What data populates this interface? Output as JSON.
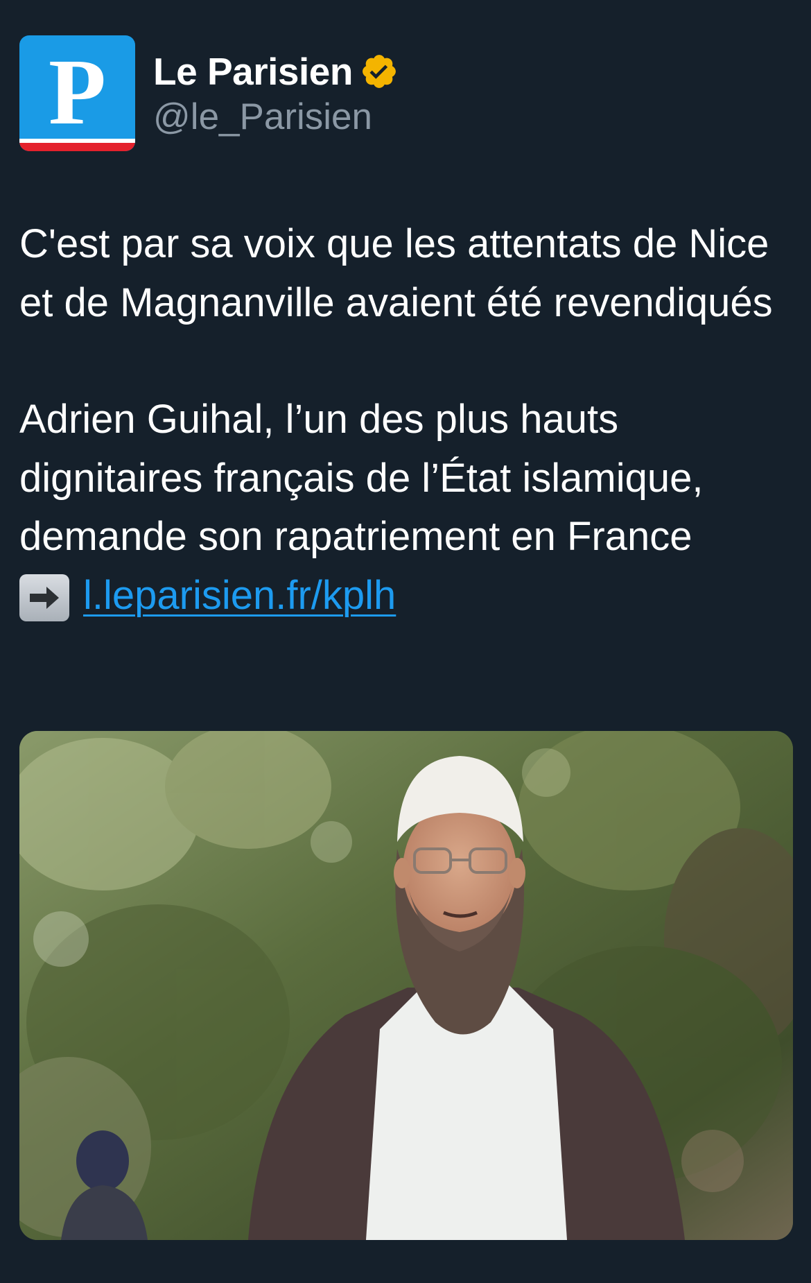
{
  "account": {
    "avatar_letter": "P",
    "display_name": "Le Parisien",
    "handle": "@le_Parisien",
    "verified_color": "#f4b400"
  },
  "tweet": {
    "paragraph_1": "C'est par sa voix que les attentats de Nice et de Magnanville avaient été revendiqués",
    "paragraph_2": "Adrien Guihal, l’un des plus hauts dignitaires français de l’État islamique, demande son rapatriement en France",
    "link_text": "l.leparisien.fr/kplh"
  },
  "colors": {
    "background": "#15202b",
    "link": "#1d9bf0",
    "avatar_blue": "#1a9be6",
    "avatar_red": "#e4212c"
  },
  "icons": {
    "verified": "verified-badge-icon",
    "arrow": "right-arrow-emoji-icon"
  }
}
